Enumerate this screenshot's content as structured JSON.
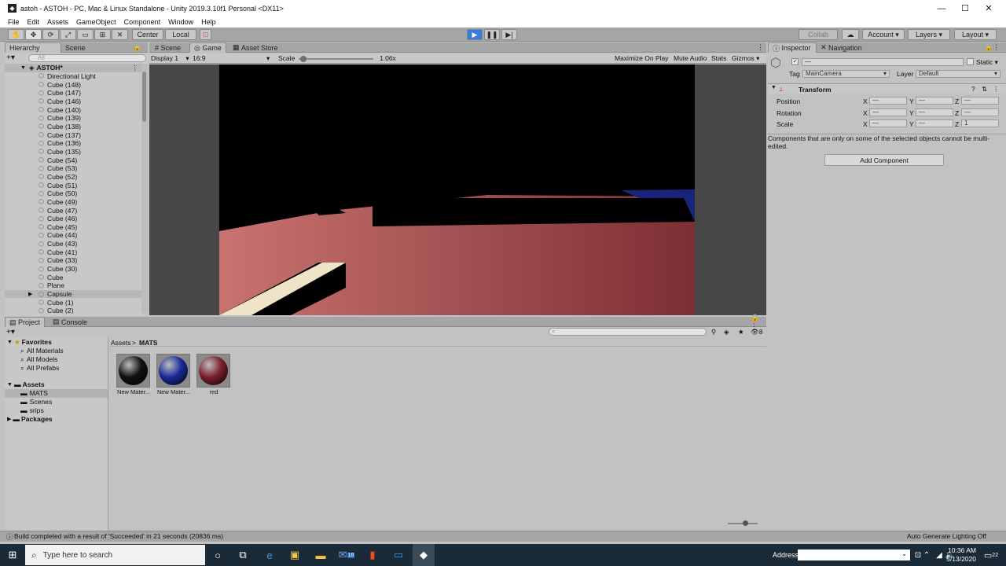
{
  "window": {
    "title": "astoh - ASTOH - PC, Mac & Linux Standalone - Unity 2019.3.10f1 Personal <DX11>"
  },
  "menu": [
    "File",
    "Edit",
    "Assets",
    "GameObject",
    "Component",
    "Window",
    "Help"
  ],
  "toolbar": {
    "center_label": "Center",
    "local_label": "Local",
    "collab_label": "Collab",
    "account_label": "Account",
    "layers_label": "Layers",
    "layout_label": "Layout"
  },
  "hierarchy": {
    "tab_label": "Hierarchy",
    "scene_tab_label": "Scene",
    "search_placeholder": "All",
    "scene_name": "ASTOH*",
    "items": [
      "Directional Light",
      "Cube (148)",
      "Cube (147)",
      "Cube (146)",
      "Cube (140)",
      "Cube (139)",
      "Cube (138)",
      "Cube (137)",
      "Cube (136)",
      "Cube (135)",
      "Cube (54)",
      "Cube (53)",
      "Cube (52)",
      "Cube (51)",
      "Cube (50)",
      "Cube (49)",
      "Cube (47)",
      "Cube (46)",
      "Cube (45)",
      "Cube (44)",
      "Cube (43)",
      "Cube (41)",
      "Cube (33)",
      "Cube (30)",
      "Cube",
      "Plane",
      "Capsule",
      "Cube (1)",
      "Cube (2)"
    ],
    "selected": "Capsule"
  },
  "game": {
    "scene_tab": "Scene",
    "game_tab": "Game",
    "asset_store_tab": "Asset Store",
    "display": "Display 1",
    "aspect": "16:9",
    "scale_label": "Scale",
    "scale_value": "1.06x",
    "maximize": "Maximize On Play",
    "mute": "Mute Audio",
    "stats": "Stats",
    "gizmos": "Gizmos"
  },
  "inspector": {
    "tab_label": "Inspector",
    "nav_tab_label": "Navigation",
    "name_value": "—",
    "static_label": "Static",
    "tag_label": "Tag",
    "tag_value": "MainCamera",
    "layer_label": "Layer",
    "layer_value": "Default",
    "transform_label": "Transform",
    "position_label": "Position",
    "rotation_label": "Rotation",
    "scale_label": "Scale",
    "x": "X",
    "y": "Y",
    "z": "Z",
    "dash": "—",
    "scale_z": "1",
    "note": "Components that are only on some of the selected objects cannot be multi-edited.",
    "add_component": "Add Component"
  },
  "project": {
    "tab_label": "Project",
    "console_tab_label": "Console",
    "favorites": "Favorites",
    "fav_items": [
      "All Materials",
      "All Models",
      "All Prefabs"
    ],
    "assets": "Assets",
    "asset_folders": [
      "MATS",
      "Scenes",
      "srips"
    ],
    "packages": "Packages",
    "breadcrumb_root": "Assets",
    "breadcrumb_current": "MATS",
    "hidden_count": "8",
    "materials": [
      {
        "label": "New Mater...",
        "color": "#111111"
      },
      {
        "label": "New Mater...",
        "color": "#1b2a9a"
      },
      {
        "label": "red",
        "color": "#7a1f2a"
      }
    ]
  },
  "status": {
    "message": "Build completed with a result of 'Succeeded' in 21 seconds (20836 ms)",
    "lighting": "Auto Generate Lighting Off"
  },
  "taskbar": {
    "search_placeholder": "Type here to search",
    "address_label": "Address",
    "time": "10:36 AM",
    "date": "5/13/2020",
    "notif_count": "22",
    "mail_count": "18"
  },
  "colors": {
    "accent": "#3a7ad8",
    "panel": "#c2c2c2",
    "toolbar": "#a5a5a5"
  }
}
